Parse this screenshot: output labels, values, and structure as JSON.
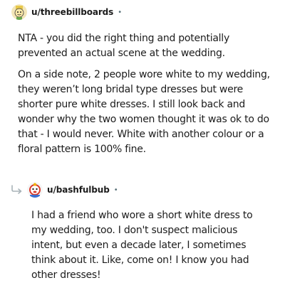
{
  "comments": [
    {
      "username": "u/threebillboards",
      "separator": "•",
      "avatar_icon": "cartoon-avatar-icon",
      "paragraphs": [
        "NTA - you did the right thing and potentially prevented an actual scene at the wedding.",
        "On a side note, 2 people wore white to my wedding, they weren’t long bridal type dresses but were shorter pure white dresses. I still look back and wonder why the two women thought it was ok to do that - I would never. White with another colour or a floral pattern is 100% fine."
      ]
    },
    {
      "username": "u/bashfulbub",
      "separator": "•",
      "avatar_icon": "cartoon-avatar-icon",
      "reply_icon": "reply-arrow-icon",
      "paragraphs": [
        "I had a friend who wore a short white dress to my wedding, too. I don't suspect malicious intent, but even a decade later, I sometimes think about it. Like, come on! I know you had other dresses!"
      ]
    }
  ],
  "colors": {
    "text": "#1c1c1c",
    "meta": "#576f76",
    "reply_arrow": "#a8b3b8",
    "avatar1_bg": "#f3e6b8",
    "avatar2_bg": "#f5f5f5"
  }
}
